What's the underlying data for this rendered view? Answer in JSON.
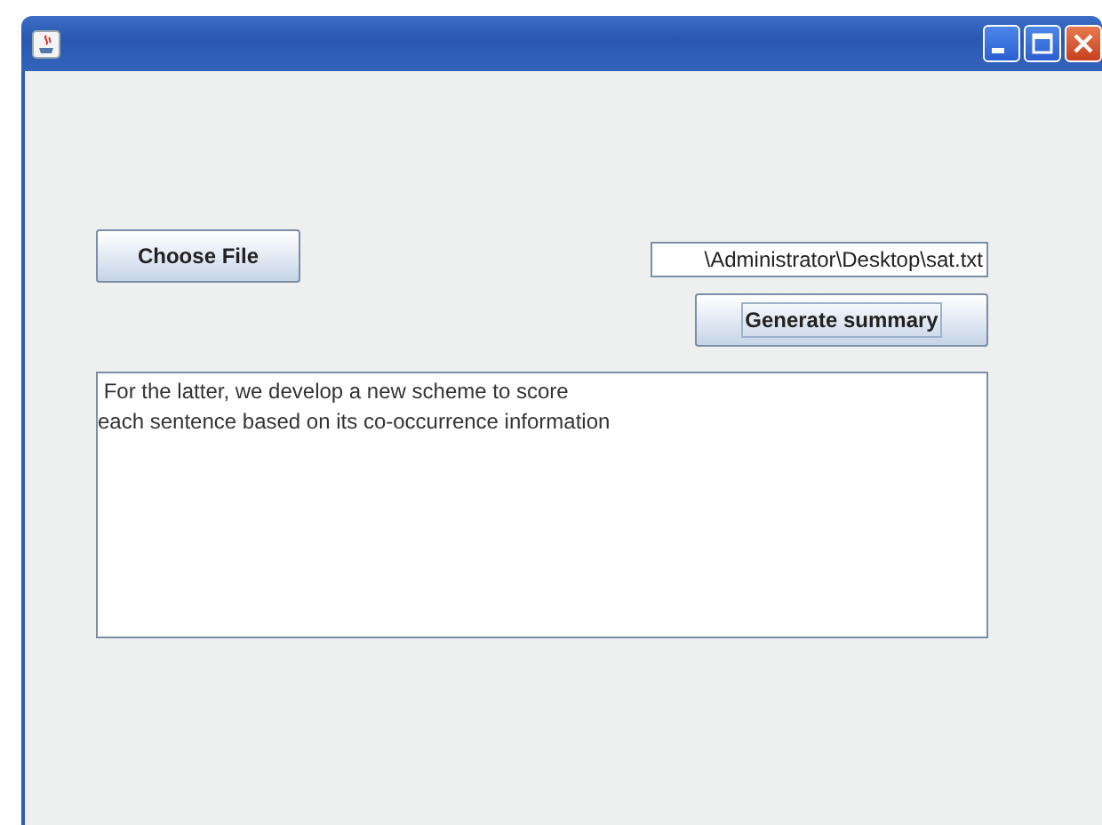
{
  "window": {
    "title_buttons": [
      {
        "kind": "minimize"
      },
      {
        "kind": "maximize"
      },
      {
        "kind": "close"
      }
    ]
  },
  "choose_button": {
    "label": "Choose File"
  },
  "file_field": {
    "value": "\\Administrator\\Desktop\\sat.txt"
  },
  "generate_button": {
    "label": "Generate summary",
    "focused": true
  },
  "summary": {
    "lines": [
      " For the latter, we develop a new scheme to score",
      "each sentence based on its co-occurrence information"
    ]
  }
}
